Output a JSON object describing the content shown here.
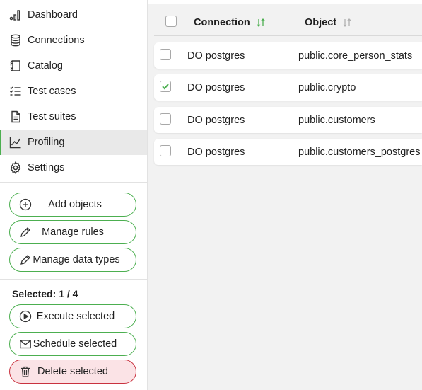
{
  "sidebar": {
    "nav": [
      {
        "label": "Dashboard",
        "icon": "bar-chart-icon"
      },
      {
        "label": "Connections",
        "icon": "database-icon"
      },
      {
        "label": "Catalog",
        "icon": "scroll-icon"
      },
      {
        "label": "Test cases",
        "icon": "checklist-icon"
      },
      {
        "label": "Test suites",
        "icon": "document-icon"
      },
      {
        "label": "Profiling",
        "icon": "line-chart-icon",
        "active": true
      },
      {
        "label": "Settings",
        "icon": "gear-icon"
      }
    ],
    "actions": {
      "add_objects": "Add objects",
      "manage_rules": "Manage rules",
      "manage_data_types": "Manage data types"
    },
    "selected_label": "Selected: 1 / 4",
    "bulk_actions": {
      "execute": "Execute selected",
      "schedule": "Schedule selected",
      "delete": "Delete selected"
    }
  },
  "table": {
    "columns": [
      "Connection",
      "Object"
    ],
    "rows": [
      {
        "connection": "DO postgres",
        "object": "public.core_person_stats",
        "checked": false
      },
      {
        "connection": "DO postgres",
        "object": "public.crypto",
        "checked": true
      },
      {
        "connection": "DO postgres",
        "object": "public.customers",
        "checked": false
      },
      {
        "connection": "DO postgres",
        "object": "public.customers_postgres",
        "checked": false
      }
    ]
  },
  "colors": {
    "accent": "#4caf50",
    "danger_border": "#c9323f",
    "danger_bg": "#fbe3e6",
    "active_nav_bg": "#e9e9e9",
    "main_bg": "#f2f2f2"
  }
}
